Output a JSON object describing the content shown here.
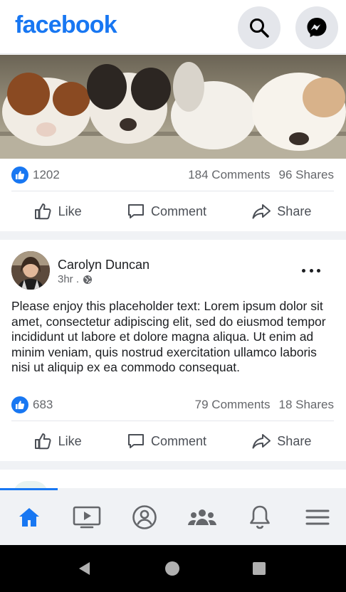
{
  "app": {
    "logo": "facebook"
  },
  "header": {
    "search_icon": "search-icon",
    "messenger_icon": "messenger-icon"
  },
  "feed": {
    "photo_post": {
      "image": "four sleeping puppies",
      "likes": "1202",
      "comments": "184 Comments",
      "shares": "96 Shares"
    },
    "text_post": {
      "author": "Carolyn Duncan",
      "time": "3hr .",
      "privacy_icon": "globe-icon",
      "text": "Please enjoy this placeholder text: Lorem ipsum dolor sit amet, consectetur adipiscing elit, sed do eiusmod tempor incididunt ut labore et dolore magna aliqua. Ut enim ad minim veniam, quis nostrud exercitation ullamco laboris nisi ut aliquip ex ea commodo consequat.",
      "likes": "683",
      "comments": "79 Comments",
      "shares": "18 Shares"
    },
    "actions": {
      "like": "Like",
      "comment": "Comment",
      "share": "Share"
    }
  },
  "bottom_nav": {
    "items": [
      "home-icon",
      "watch-icon",
      "profile-icon",
      "groups-icon",
      "notifications-icon",
      "menu-icon"
    ],
    "active": "home-icon",
    "active_color": "#1877f2",
    "inactive_color": "#65676b"
  },
  "system_bar": {
    "buttons": [
      "back-icon",
      "home-circle-icon",
      "recents-icon"
    ]
  }
}
